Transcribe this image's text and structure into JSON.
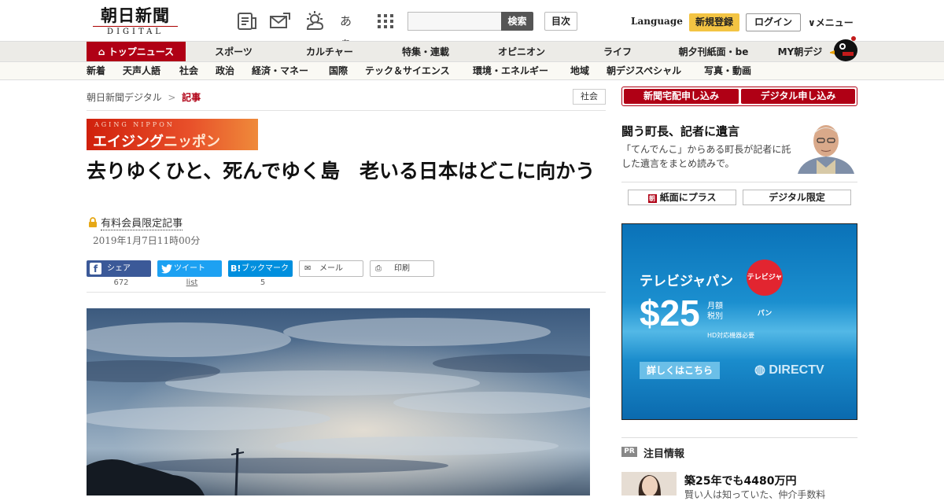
{
  "header": {
    "logo_jp": "朝日新聞",
    "logo_en": "DIGITAL",
    "search_button": "検索",
    "toc_button": "目次",
    "language": "Language",
    "register": "新規登録",
    "login": "ログイン",
    "menu": "メニュー",
    "icons": [
      "newspaper-icon",
      "mail-icon",
      "weather-icon",
      "text-size-icon",
      "grid-menu-icon"
    ],
    "text_size_glyph": "あぁ"
  },
  "nav_primary": [
    "トップニュース",
    "スポーツ",
    "カルチャー",
    "特集・連載",
    "オピニオン",
    "ライフ",
    "朝夕刊紙面・be",
    "MY朝デジ"
  ],
  "nav_secondary": [
    "新着",
    "天声人語",
    "社会",
    "政治",
    "経済・マネー",
    "国際",
    "テック＆サイエンス",
    "環境・エネルギー",
    "地域",
    "朝デジスペシャル",
    "写真・動画"
  ],
  "breadcrumb": {
    "home": "朝日新聞デジタル",
    "separator": ">",
    "current": "記事"
  },
  "category_tag": "社会",
  "series": {
    "small": "AGING NIPPON",
    "big_a": "エイジング",
    "big_b": "ニッポン"
  },
  "article": {
    "title": "去りゆくひと、死んでゆく島　老いる日本はどこに向かう",
    "members_label": "有料会員限定記事",
    "date": "2019年1月7日11時00分"
  },
  "share": {
    "facebook": {
      "label": "シェア",
      "count": "672"
    },
    "twitter": {
      "label": "ツイート",
      "count": "list"
    },
    "hatena": {
      "label": "ブックマーク",
      "count": "5"
    },
    "mail": {
      "label": "メール"
    },
    "print": {
      "label": "印刷"
    }
  },
  "sidebar": {
    "subscribe_paper": "新聞宅配申し込み",
    "subscribe_digital": "デジタル申し込み",
    "promo_title": "闘う町長、記者に遺言",
    "promo_text": "「てんでんこ」からある町長が記者に託した遺言をまとめ読みで。",
    "plus_button": "紙面にプラス",
    "digital_only_button": "デジタル限定",
    "ad": {
      "brand": "テレビジャパン",
      "brand_badge": "テレビジャパン",
      "price": "$25",
      "monthly": "月額",
      "tax": "税別",
      "hd_note": "HD対応機器必要",
      "cta": "詳しくはこちら",
      "partner": "DIRECTV"
    },
    "pr_badge": "PR",
    "pr_title": "注目情報",
    "pr_head": "築25年でも4480万円",
    "pr_sub": "賢い人は知っていた、仲介手数料"
  },
  "colors": {
    "brand_red": "#b00015",
    "facebook": "#3b5998",
    "twitter": "#1da1f2",
    "hatena": "#008fde",
    "register_yellow": "#f3c443"
  }
}
